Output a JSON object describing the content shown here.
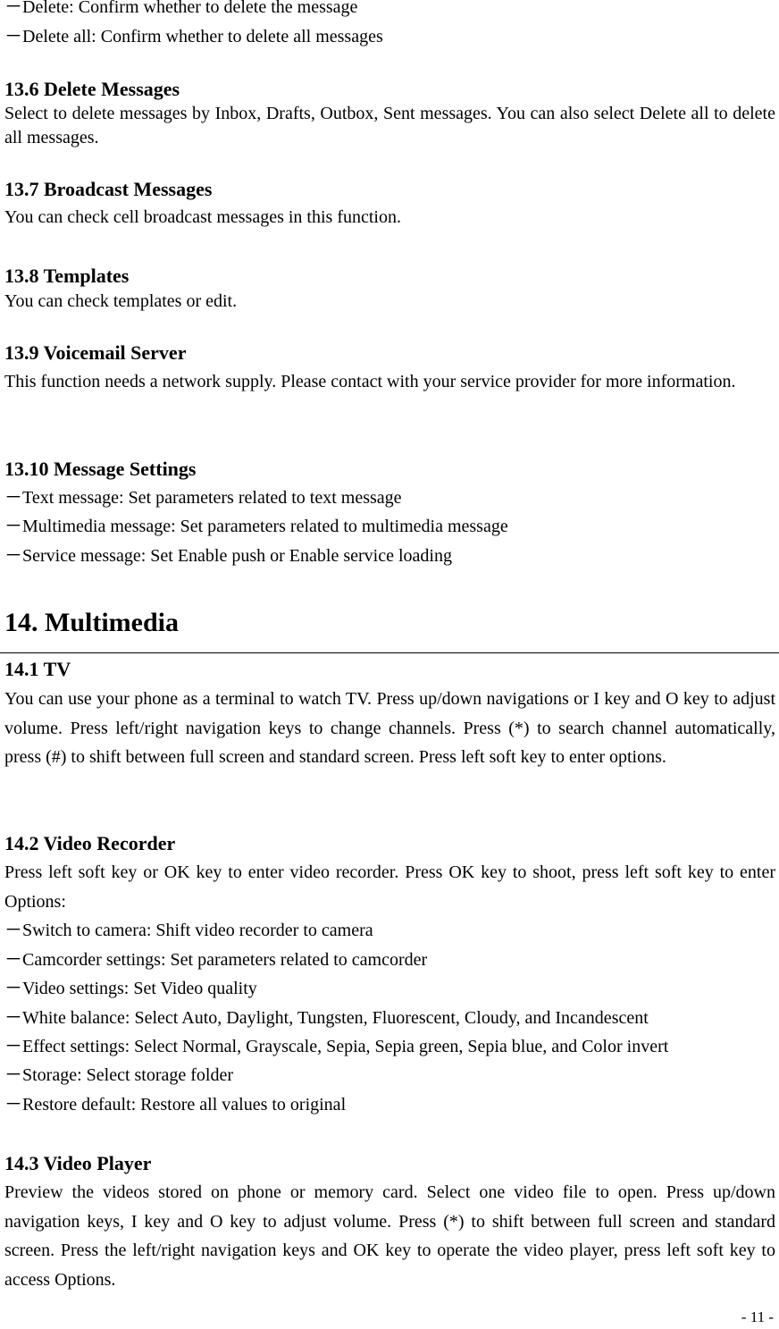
{
  "top_list": [
    "－Delete: Confirm whether to delete the message",
    "－Delete all: Confirm whether to delete all messages"
  ],
  "sections": {
    "s13_6": {
      "title": "13.6 Delete Messages",
      "body": "Select to delete messages by Inbox, Drafts, Outbox, Sent messages. You can also select Delete all to delete all messages."
    },
    "s13_7": {
      "title": "13.7 Broadcast Messages",
      "body": "You can check cell broadcast messages in this function."
    },
    "s13_8": {
      "title": "13.8 Templates",
      "body": "You can check templates or edit."
    },
    "s13_9": {
      "title": "13.9 Voicemail Server",
      "body": "This function needs a network supply. Please contact with your service provider for more information."
    },
    "s13_10": {
      "title": "13.10 Message Settings",
      "items": [
        "－Text message: Set parameters related to text message",
        "－Multimedia message: Set parameters related to multimedia message",
        "－Service message: Set Enable push or Enable service loading"
      ]
    },
    "ch14": {
      "title": "14. Multimedia"
    },
    "s14_1": {
      "title": "14.1 TV",
      "body": "You can use your phone as a terminal to watch TV. Press up/down navigations or I key and O key to adjust volume. Press left/right navigation keys to change channels. Press (*) to search channel automatically, press (#) to shift between full screen and standard screen. Press left soft key to enter options."
    },
    "s14_2": {
      "title": "14.2 Video Recorder",
      "body": "Press left soft key or OK key to enter video recorder. Press OK key to shoot, press left soft key to enter Options:",
      "items": [
        "－Switch to camera: Shift video recorder to camera",
        "－Camcorder settings: Set parameters related to camcorder",
        "－Video settings: Set Video quality",
        "－White balance: Select Auto, Daylight, Tungsten, Fluorescent, Cloudy, and Incandescent",
        "－Effect settings: Select Normal, Grayscale, Sepia, Sepia green, Sepia blue, and Color invert",
        "－Storage: Select storage folder",
        "－Restore default: Restore all values to original"
      ]
    },
    "s14_3": {
      "title": "14.3 Video Player",
      "body": "Preview the videos stored on phone or memory card. Select one video file to open. Press up/down navigation keys, I key and O key to adjust volume. Press (*) to shift between full screen and standard screen. Press the left/right navigation keys and OK key to operate the video player, press left soft key to access Options."
    }
  },
  "page_number": "- 11 -"
}
